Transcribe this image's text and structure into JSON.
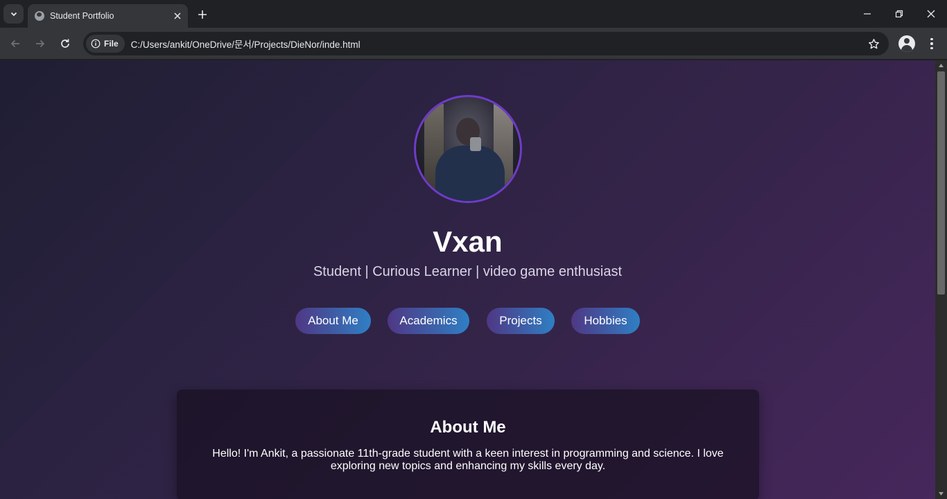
{
  "browser": {
    "tab_title": "Student Portfolio",
    "chip_label": "File",
    "url": "C:/Users/ankit/OneDrive/문서/Projects/DieNor/inde.html"
  },
  "profile": {
    "name": "Vxan",
    "tagline": "Student | Curious Learner | video game enthusiast"
  },
  "nav": {
    "items": [
      {
        "label": "About Me"
      },
      {
        "label": "Academics"
      },
      {
        "label": "Projects"
      },
      {
        "label": "Hobbies"
      }
    ]
  },
  "about": {
    "title": "About Me",
    "text": "Hello! I'm Ankit, a passionate 11th-grade student with a keen interest in programming and science. I love exploring new topics and enhancing my skills every day."
  },
  "colors": {
    "avatar_border": "#6f3bc8",
    "button_gradient_start": "#4f3784",
    "button_gradient_end": "#2f7fc4"
  },
  "icons": [
    "tab-search-icon",
    "globe-icon",
    "close-icon",
    "plus-icon",
    "minimize-icon",
    "restore-icon",
    "back-icon",
    "forward-icon",
    "reload-icon",
    "info-icon",
    "star-icon",
    "profile-icon",
    "menu-icon"
  ]
}
